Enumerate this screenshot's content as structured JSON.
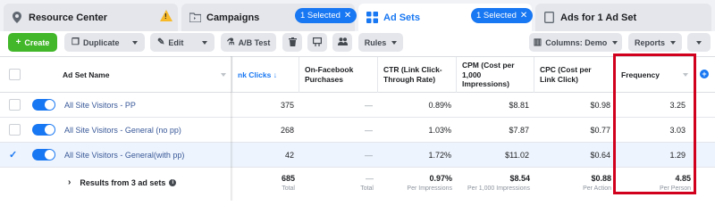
{
  "tabs": [
    {
      "label": "Resource Center",
      "icon": "map-pin-icon"
    },
    {
      "label": "Campaigns",
      "icon": "folder-icon",
      "selected_label": "1 Selected"
    },
    {
      "label": "Ad Sets",
      "icon": "grid-icon",
      "selected_label": "1 Selected",
      "active": true
    },
    {
      "label": "Ads for 1 Ad Set",
      "icon": "document-icon"
    }
  ],
  "toolbar": {
    "create_label": "Create",
    "duplicate_label": "Duplicate",
    "edit_label": "Edit",
    "ab_test_label": "A/B Test",
    "rules_label": "Rules",
    "columns_label": "Columns: Demo",
    "reports_label": "Reports"
  },
  "table": {
    "headers": {
      "name": "Ad Set Name",
      "link_clicks": "nk Clicks",
      "sort_indicator": "↓",
      "on_facebook_purchases": "On-Facebook Purchases",
      "ctr": "CTR (Link Click-Through Rate)",
      "cpm": "CPM (Cost per 1,000 Impressions)",
      "cpc": "CPC (Cost per Link Click)",
      "frequency": "Frequency"
    },
    "rows": [
      {
        "name": "All Site Visitors - PP",
        "link_clicks": "375",
        "purchases": "—",
        "ctr": "0.89%",
        "cpm": "$8.81",
        "cpc": "$0.98",
        "frequency": "3.25",
        "checked": false,
        "active": true
      },
      {
        "name": "All Site Visitors - General (no pp)",
        "link_clicks": "268",
        "purchases": "—",
        "ctr": "1.03%",
        "cpm": "$7.87",
        "cpc": "$0.77",
        "frequency": "3.03",
        "checked": false,
        "active": true
      },
      {
        "name": "All Site Visitors - General(with pp)",
        "link_clicks": "42",
        "purchases": "—",
        "ctr": "1.72%",
        "cpm": "$11.02",
        "cpc": "$0.64",
        "frequency": "1.29",
        "checked": true,
        "active": true
      }
    ],
    "totals": {
      "label": "Results from 3 ad sets",
      "link_clicks": "685",
      "link_clicks_sub": "Total",
      "purchases": "—",
      "purchases_sub": "Total",
      "ctr": "0.97%",
      "ctr_sub": "Per Impressions",
      "cpm": "$8.54",
      "cpm_sub": "Per 1,000 Impressions",
      "cpc": "$0.88",
      "cpc_sub": "Per Action",
      "frequency": "4.85",
      "frequency_sub": "Per Person"
    }
  },
  "colors": {
    "accent": "#1877f2",
    "create": "#42b72a",
    "highlight_box": "#d1001c",
    "warning": "#f7b928"
  }
}
